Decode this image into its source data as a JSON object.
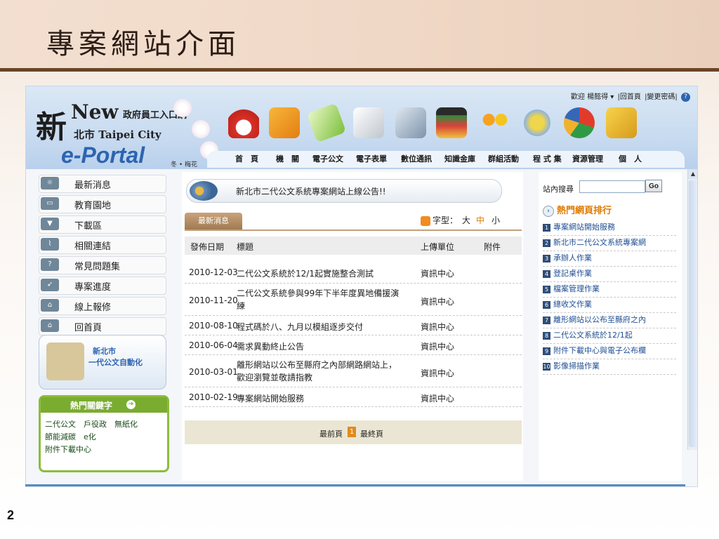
{
  "slide": {
    "title": "專案網站介面",
    "page_number": "2"
  },
  "portal": {
    "logo": {
      "char": "新",
      "new": "New",
      "gov": "政府員工入口網",
      "city_prefix": "北市",
      "city": "Taipei City",
      "eportal": "e-Portal",
      "season": "冬 • 梅花"
    },
    "topbar": {
      "welcome": "歡迎 楊懿得 ▾",
      "home": "|回首頁",
      "change_pw": "|變更密碼|",
      "help": "?"
    },
    "nav": [
      "首　頁",
      "機　關",
      "電子公文",
      "電子表單",
      "數位通訊",
      "知識金庫",
      "群組活動",
      "程 式 集",
      "資源管理",
      "個　人"
    ],
    "sidebar": [
      {
        "label": "最新消息",
        "icon": "☼"
      },
      {
        "label": "教育園地",
        "icon": "▭"
      },
      {
        "label": "下載區",
        "icon": "▼"
      },
      {
        "label": "相關連結",
        "icon": "⌇"
      },
      {
        "label": "常見問題集",
        "icon": "?"
      },
      {
        "label": "專案進度",
        "icon": "➶"
      },
      {
        "label": "線上報修",
        "icon": "⌂"
      },
      {
        "label": "回首頁",
        "icon": "⌂"
      }
    ],
    "promo": {
      "line1": "新北市",
      "line2": "一代公文自動化"
    },
    "keywords": {
      "title": "熱門關鍵字",
      "lines": [
        "二代公文　戶役政　無紙化",
        "節能減碳　e化",
        "附件下載中心"
      ]
    },
    "announcement": "新北市二代公文系統專案網站上線公告!!",
    "news_tab": "最新消息",
    "font_size": {
      "label": "字型：",
      "big": "大",
      "mid": "中",
      "small": "小"
    },
    "table": {
      "headers": {
        "date": "發佈日期",
        "title": "標題",
        "unit": "上傳單位",
        "attach": "附件"
      },
      "rows": [
        {
          "date": "2010-12-03",
          "title": "二代公文系統於12/1起實施整合測試",
          "title2": "",
          "unit": "資訊中心"
        },
        {
          "date": "2010-11-20",
          "title": "二代公文系統參與99年下半年度異地備援演",
          "title2": "練",
          "unit": "資訊中心"
        },
        {
          "date": "2010-08-10",
          "title": "程式碼於八、九月以模組逐步交付",
          "title2": "",
          "unit": "資訊中心"
        },
        {
          "date": "2010-06-04",
          "title": "需求異動終止公告",
          "title2": "",
          "unit": "資訊中心"
        },
        {
          "date": "2010-03-01",
          "title": "離形網站以公布至縣府之內部網路網站上，",
          "title2": "歡迎瀏覽並敬請指教",
          "unit": "資訊中心"
        },
        {
          "date": "2010-02-19",
          "title": "專案網站開始服務",
          "title2": "",
          "unit": "資訊中心"
        }
      ]
    },
    "pager": {
      "first": "最前頁",
      "current": "1",
      "last": "最終頁"
    },
    "search": {
      "label": "站內搜尋",
      "value": "",
      "button": "Go"
    },
    "hot_pages": {
      "title": "熱門網頁排行",
      "items": [
        {
          "n": "1",
          "label": "專案網站開始服務"
        },
        {
          "n": "2",
          "label": "新北市二代公文系統專案網"
        },
        {
          "n": "3",
          "label": "承辦人作業"
        },
        {
          "n": "4",
          "label": "登記桌作業"
        },
        {
          "n": "5",
          "label": "檔案管理作業"
        },
        {
          "n": "6",
          "label": "總收文作業"
        },
        {
          "n": "7",
          "label": "離形網站以公布至縣府之內"
        },
        {
          "n": "8",
          "label": "二代公文系統於12/1起"
        },
        {
          "n": "9",
          "label": "附件下載中心與電子公布欄"
        },
        {
          "n": "10",
          "label": "影像掃描作業"
        }
      ]
    },
    "colors": {
      "accent_blue": "#2d64b0",
      "orange": "#e07b00",
      "green": "#7aac30"
    }
  }
}
